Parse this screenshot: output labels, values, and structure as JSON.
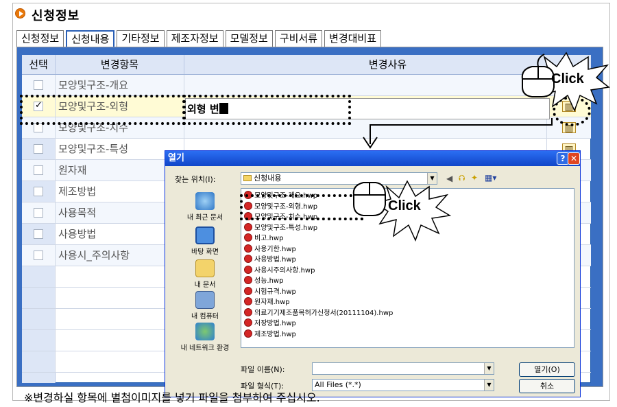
{
  "section": {
    "title": "신청정보"
  },
  "tabs": [
    "신청정보",
    "신청내용",
    "기타정보",
    "제조자정보",
    "모델정보",
    "구비서류",
    "변경대비표"
  ],
  "active_tab": 1,
  "table": {
    "headers": [
      "선택",
      "변경항목",
      "변경사유"
    ],
    "rows": [
      {
        "checked": false,
        "item": "모양및구조-개요",
        "reason": ""
      },
      {
        "checked": true,
        "item": "모양및구조-외형",
        "reason": "외형 변"
      },
      {
        "checked": false,
        "item": "모양및구조-치수",
        "reason": ""
      },
      {
        "checked": false,
        "item": "모양및구조-특성",
        "reason": ""
      },
      {
        "checked": false,
        "item": "원자재",
        "reason": ""
      },
      {
        "checked": false,
        "item": "제조방법",
        "reason": ""
      },
      {
        "checked": false,
        "item": "사용목적",
        "reason": ""
      },
      {
        "checked": false,
        "item": "사용방법",
        "reason": ""
      },
      {
        "checked": false,
        "item": "사용시_주의사항",
        "reason": ""
      }
    ]
  },
  "note": "※변경하실 항목에 별첨이미지를 넣기 파일을 첨부하여 주십시오.",
  "callouts": {
    "click1": "Click",
    "click2": "Click"
  },
  "dialog": {
    "title": "열기",
    "help_label": "?",
    "close_label": "✕",
    "lookin_label": "찾는 위치(I):",
    "lookin_value": "신청내용",
    "places": [
      "내 최근 문서",
      "바탕 화면",
      "내 문서",
      "내 컴퓨터",
      "내 네트워크 환경"
    ],
    "files": [
      "모양및구조-개요.hwp",
      "모양및구조-외형.hwp",
      "모양및구조-치수.hwp",
      "모양및구조-특성.hwp",
      "비고.hwp",
      "사용기한.hwp",
      "사용방법.hwp",
      "사용시주의사항.hwp",
      "성능.hwp",
      "시험규격.hwp",
      "원자재.hwp",
      "의료기기제조품목허가신청서(20111104).hwp",
      "저장방법.hwp",
      "제조방법.hwp"
    ],
    "filename_label": "파일 이름(N):",
    "filename_value": "",
    "filetype_label": "파일 형식(T):",
    "filetype_value": "All Files (*.*)",
    "open_button": "열기(O)",
    "cancel_button": "취소"
  },
  "colors": {
    "accent": "#2a5fb5",
    "title_bar": "#1045c8",
    "bullet": "#e8780a"
  }
}
